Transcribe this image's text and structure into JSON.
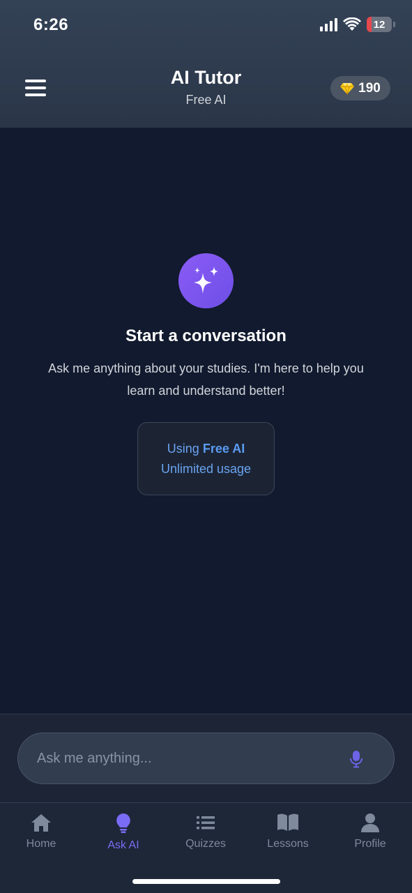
{
  "status_bar": {
    "time": "6:26",
    "battery": "12"
  },
  "header": {
    "title": "AI Tutor",
    "subtitle": "Free AI",
    "gems": "190"
  },
  "empty_state": {
    "title": "Start a conversation",
    "description": "Ask me anything about your studies. I'm here to help you learn and understand better!",
    "card_prefix": "Using",
    "card_model": "Free AI",
    "card_usage": "Unlimited usage"
  },
  "composer": {
    "placeholder": "Ask me anything..."
  },
  "tabs": [
    {
      "label": "Home",
      "icon": "home-icon"
    },
    {
      "label": "Ask AI",
      "icon": "lightbulb-icon"
    },
    {
      "label": "Quizzes",
      "icon": "list-icon"
    },
    {
      "label": "Lessons",
      "icon": "book-icon"
    },
    {
      "label": "Profile",
      "icon": "user-icon"
    }
  ],
  "colors": {
    "accent": "#7a6cf5",
    "link": "#5b9bf0",
    "background": "#111a2e"
  }
}
